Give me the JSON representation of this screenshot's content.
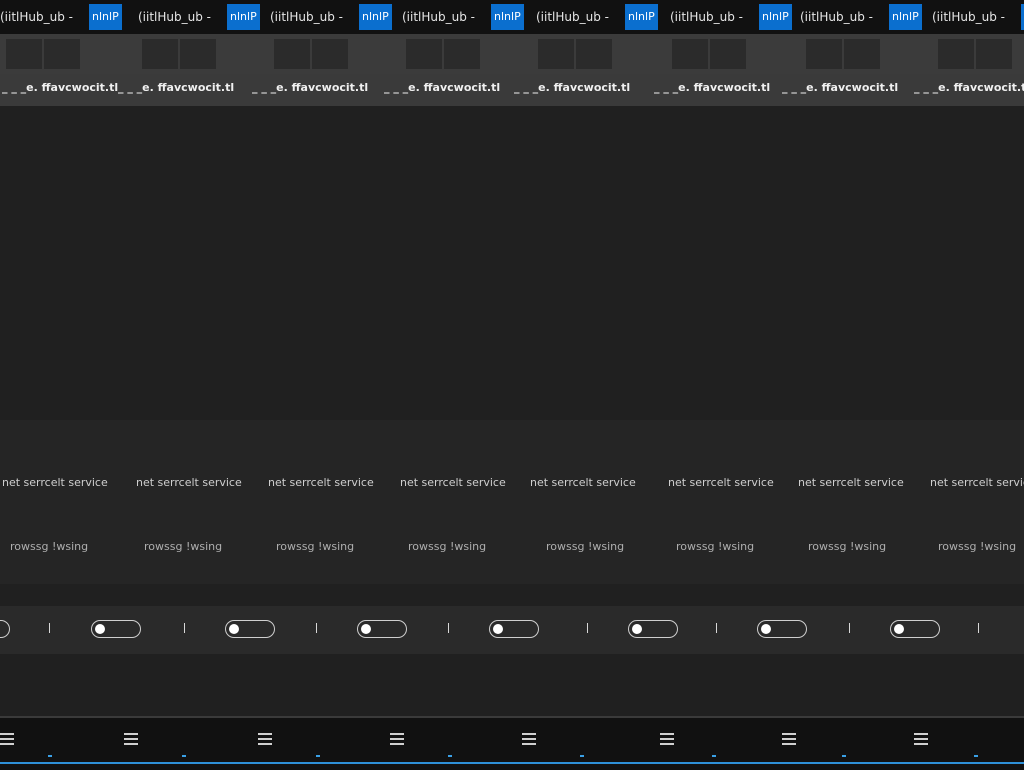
{
  "tab_title": "(iitlHub_ub -",
  "tab_pin_label": "nlnlP",
  "favorites_label": "_ _ _e. ffavcwocit.tl",
  "service_text": "net serrcelt service",
  "browsing_text": "rowssg !wsing",
  "colors": {
    "accent_blue": "#0b6fcf",
    "taskbar_highlight": "#3aa0e6"
  },
  "icons": {
    "cursor": "arrow-cursor-icon"
  }
}
